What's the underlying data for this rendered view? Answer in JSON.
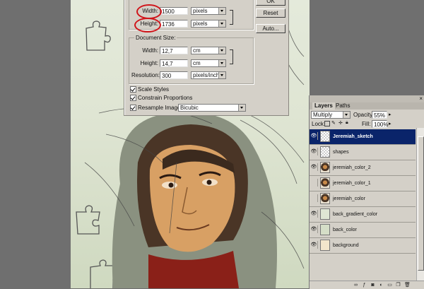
{
  "dialog": {
    "ok_label": "OK",
    "reset_label": "Reset",
    "auto_label": "Auto...",
    "pixel_dimensions": {
      "width_label": "Width:",
      "width_value": "1500",
      "width_unit": "pixels",
      "height_label": "Height:",
      "height_value": "1736",
      "height_unit": "pixels"
    },
    "document_size": {
      "legend": "Document Size:",
      "width_label": "Width:",
      "width_value": "12,7",
      "width_unit": "cm",
      "height_label": "Height:",
      "height_value": "14,7",
      "height_unit": "cm",
      "resolution_label": "Resolution:",
      "resolution_value": "300",
      "resolution_unit": "pixels/inch"
    },
    "options": {
      "scale_styles": "Scale Styles",
      "constrain_proportions": "Constrain Proportions",
      "resample_label": "Resample Image:",
      "resample_value": "Bicubic"
    }
  },
  "layers_panel": {
    "tabs": [
      "Layers",
      "Paths"
    ],
    "blend_mode": "Multiply",
    "opacity_label": "Opacity:",
    "opacity_value": "55%",
    "lock_label": "Lock:",
    "fill_label": "Fill:",
    "fill_value": "100%",
    "layers": [
      {
        "name": "Jeremiah_sketch",
        "visible": true,
        "active": true
      },
      {
        "name": "shapes",
        "visible": true,
        "active": false
      },
      {
        "name": "jeremiah_color_2",
        "visible": true,
        "active": false
      },
      {
        "name": "jeremiah_color_1",
        "visible": false,
        "active": false
      },
      {
        "name": "jeremiah_color",
        "visible": false,
        "active": false
      },
      {
        "name": "back_gradient_color",
        "visible": true,
        "active": false
      },
      {
        "name": "back_color",
        "visible": true,
        "active": false
      },
      {
        "name": "background",
        "visible": true,
        "active": false
      }
    ]
  },
  "colors": {
    "selection_blue": "#0a246a",
    "annotation_red": "#d0141a",
    "canvas_bg": "#e4eadb"
  }
}
